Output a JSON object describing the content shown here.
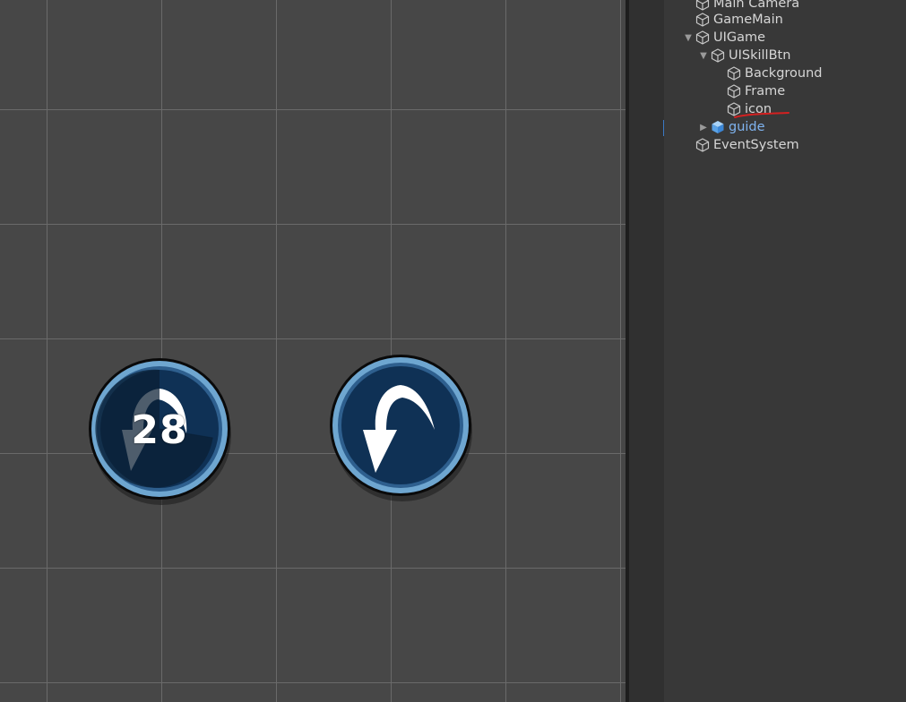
{
  "scene": {
    "buttons": [
      {
        "name": "skill-button-cooldown",
        "cooldown_text": "28",
        "state": "cooldown",
        "cooldown_fraction": 0.72
      },
      {
        "name": "skill-button-ready",
        "cooldown_text": "",
        "state": "ready"
      }
    ],
    "colors": {
      "ring": "#6ea6d0",
      "face": "#0f3155",
      "cooldown_overlay": "#0a1e33",
      "grid_bg": "#474747",
      "grid_line": "#6a6a6a"
    },
    "icon_name": "curved-arrow-icon"
  },
  "hierarchy": {
    "items": [
      {
        "label": "Main Camera",
        "depth": 0,
        "expander": "none",
        "prefab": false
      },
      {
        "label": "GameMain",
        "depth": 0,
        "expander": "none",
        "prefab": false
      },
      {
        "label": "UIGame",
        "depth": 0,
        "expander": "expanded",
        "prefab": false
      },
      {
        "label": "UISkillBtn",
        "depth": 1,
        "expander": "expanded",
        "prefab": false
      },
      {
        "label": "Background",
        "depth": 2,
        "expander": "none",
        "prefab": false
      },
      {
        "label": "Frame",
        "depth": 2,
        "expander": "none",
        "prefab": false
      },
      {
        "label": "icon",
        "depth": 2,
        "expander": "none",
        "prefab": false
      },
      {
        "label": "guide",
        "depth": 1,
        "expander": "collapsed",
        "prefab": true
      },
      {
        "label": "EventSystem",
        "depth": 0,
        "expander": "none",
        "prefab": false
      }
    ],
    "colors": {
      "text": "#d6d6d6",
      "prefab_text": "#7fb3ef",
      "annotation": "#d42020"
    }
  }
}
